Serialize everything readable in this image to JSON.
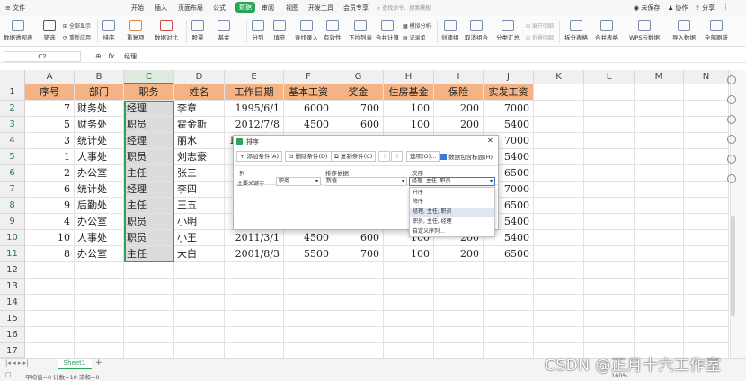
{
  "menu": {
    "file": "文件",
    "items": [
      "开始",
      "插入",
      "页面布局",
      "公式",
      "数据",
      "审阅",
      "视图",
      "开发工具",
      "会员专享"
    ],
    "active": "数据",
    "search_placeholder": "查找命令、搜索模板",
    "unsaved": "未保存",
    "collab": "协作",
    "share": "分享"
  },
  "ribbon": {
    "pivot": "数据透视表",
    "filter": "筛选",
    "show_all": "全部显示",
    "reapply": "重新应用",
    "sort": "排序",
    "dup": "重复项",
    "compare": "数据对比",
    "stock": "股票",
    "fund": "基金",
    "split": "分列",
    "fill": "填充",
    "lookup": "查找录入",
    "valid": "有效性",
    "dropdown": "下拉列表",
    "consolidate": "合并计算",
    "simulate": "模拟分析",
    "record": "记录单",
    "group": "创建组",
    "ungroup": "取消组合",
    "subtotal": "分类汇总",
    "expand": "展开明细",
    "collapse": "折叠明细",
    "split_table": "拆分表格",
    "merge_table": "合并表格",
    "wps_cloud": "WPS云数据",
    "import": "导入数据",
    "refresh_all": "全部刷新"
  },
  "formula_bar": {
    "name_box": "C2",
    "fx": "fx",
    "value": "经理"
  },
  "columns": [
    "A",
    "B",
    "C",
    "D",
    "E",
    "F",
    "G",
    "H",
    "I",
    "J",
    "K",
    "L",
    "M",
    "N"
  ],
  "rows": [
    "1",
    "2",
    "3",
    "4",
    "5",
    "6",
    "7",
    "8",
    "9",
    "10",
    "11",
    "12",
    "13",
    "14",
    "15",
    "16",
    "17",
    "18",
    "19",
    "20"
  ],
  "table_header": [
    "序号",
    "部门",
    "职务",
    "姓名",
    "工作日期",
    "基本工资",
    "奖金",
    "住房基金",
    "保险",
    "实发工资"
  ],
  "table_rows": [
    [
      "7",
      "财务处",
      "经理",
      "李章",
      "1995/6/1",
      "6000",
      "700",
      "100",
      "200",
      "7000"
    ],
    [
      "5",
      "财务处",
      "职员",
      "霍金斯",
      "2012/7/8",
      "4500",
      "600",
      "100",
      "200",
      "5400"
    ],
    [
      "3",
      "统计处",
      "经理",
      "丽水",
      "1998/3/21",
      "6000",
      "700",
      "100",
      "200",
      "7000"
    ],
    [
      "1",
      "人事处",
      "职员",
      "刘志豪",
      "2002/3/4",
      "4500",
      "600",
      "100",
      "200",
      "5400"
    ],
    [
      "2",
      "办公室",
      "主任",
      "张三",
      "",
      "",
      "",
      "",
      "",
      "6500"
    ],
    [
      "6",
      "统计处",
      "经理",
      "李四",
      "",
      "",
      "",
      "",
      "",
      "7000"
    ],
    [
      "9",
      "后勤处",
      "主任",
      "王五",
      "",
      "",
      "",
      "",
      "",
      "6500"
    ],
    [
      "4",
      "办公室",
      "职员",
      "小明",
      "",
      "",
      "",
      "",
      "",
      "5400"
    ],
    [
      "10",
      "人事处",
      "职员",
      "小王",
      "2011/3/1",
      "4500",
      "600",
      "100",
      "200",
      "5400"
    ],
    [
      "8",
      "办公室",
      "主任",
      "大白",
      "2001/8/3",
      "5500",
      "700",
      "100",
      "200",
      "6500"
    ]
  ],
  "dialog": {
    "title": "排序",
    "add": "添加条件(A)",
    "delete": "删除条件(D)",
    "copy": "复制条件(C)",
    "options": "选项(O)...",
    "has_header": "数据包含标题(H)",
    "col_label": "列",
    "basis_label": "排序依据",
    "order_label": "次序",
    "primary_key": "主要关键字",
    "key_value": "职务",
    "basis_value": "数值",
    "order_value": "经理, 主任, 职员",
    "options_list": [
      "升序",
      "降序",
      "经理, 主任, 职员",
      "职员, 主任, 经理",
      "自定义序列..."
    ]
  },
  "sheet": {
    "tab": "Sheet1",
    "add": "+"
  },
  "status": {
    "summary": "平均值=0  计数=10  求和=0",
    "zoom": "160%"
  },
  "watermark": "CSDN @正月十六工作室",
  "colors": {
    "accent": "#2aa457",
    "header_fill": "#f3b384",
    "selected_col": "#dcdcdc"
  }
}
